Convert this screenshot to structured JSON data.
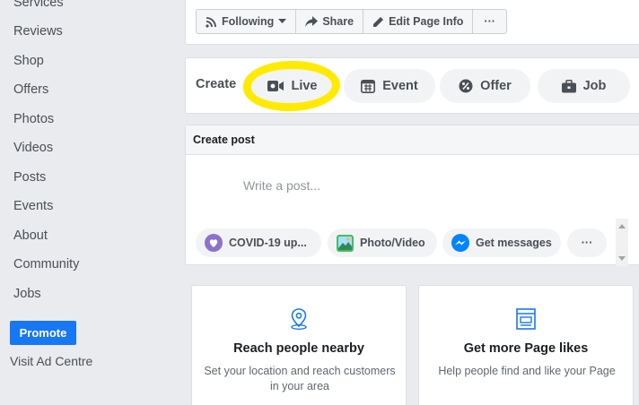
{
  "sidebar": {
    "items": [
      "Services",
      "Reviews",
      "Shop",
      "Offers",
      "Photos",
      "Videos",
      "Posts",
      "Events",
      "About",
      "Community",
      "Jobs"
    ],
    "promote_label": "Promote",
    "visit_ad_label": "Visit Ad Centre"
  },
  "toolbar": {
    "following_label": "Following",
    "share_label": "Share",
    "edit_label": "Edit Page Info",
    "more_label": "···"
  },
  "create": {
    "label": "Create",
    "options": [
      "Live",
      "Event",
      "Offer",
      "Job"
    ]
  },
  "post": {
    "header": "Create post",
    "placeholder": "Write a post...",
    "chips": [
      "COVID-19 up...",
      "Photo/Video",
      "Get messages"
    ],
    "more_label": "···"
  },
  "cards": {
    "reach_title": "Reach people nearby",
    "reach_desc": "Set your location and reach customers in your area",
    "likes_title": "Get more Page likes",
    "likes_desc": "Help people find and like your Page"
  },
  "colors": {
    "accent": "#1877f2",
    "highlight": "#ffea00",
    "background": "#e9ebee"
  }
}
